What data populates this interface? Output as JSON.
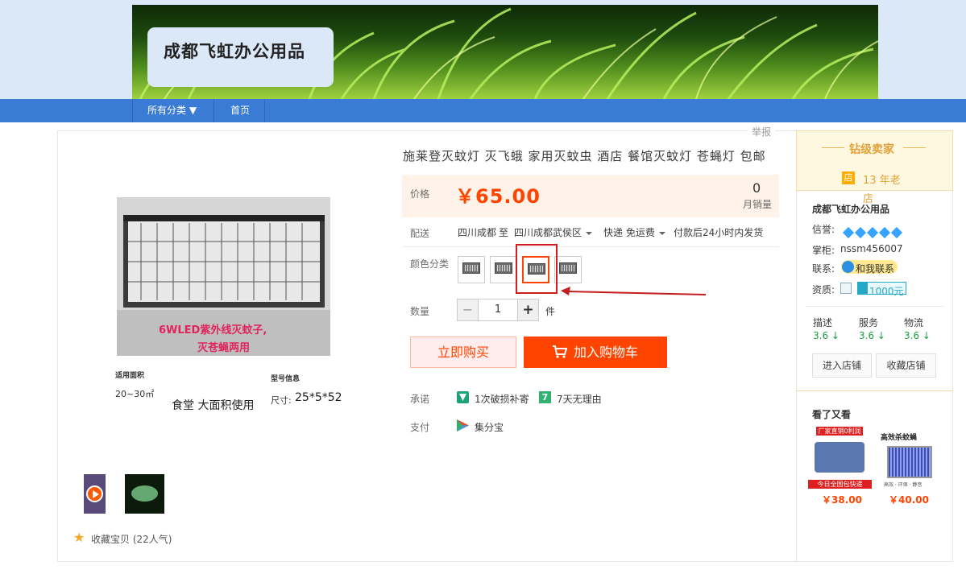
{
  "shop": {
    "name": "成都飞虹办公用品"
  },
  "nav": {
    "items": [
      {
        "label": "所有分类 ▼"
      },
      {
        "label": "首页"
      }
    ]
  },
  "report_label": "举报",
  "product": {
    "title": "施莱登灭蚊灯 灭飞蛾 家用灭蚊虫 酒店 餐馆灭蚊灯 苍蝇灯 包邮",
    "image_caption_line1": "6WLED紫外线灭蚊子,",
    "image_caption_line2": "灭苍蝇两用",
    "info_area_label": "适用面积",
    "info_area_value": "20~30㎡",
    "info_model_label": "型号信息",
    "info_size_label": "尺寸:",
    "info_size_value": "25*5*52",
    "info_usage": "食堂 大面积使用",
    "price_label": "价格",
    "price": "￥65.00",
    "sales_count": "0",
    "sales_label": "月销量",
    "shipping_label": "配送",
    "ship_from": "四川成都",
    "ship_to_word": "至",
    "ship_to": "四川成都武侯区",
    "ship_method": "快递 免运费",
    "ship_time": "付款后24小时内发货",
    "color_label": "颜色分类",
    "quantity_label": "数量",
    "quantity_value": "1",
    "quantity_unit": "件",
    "qty_minus": "−",
    "qty_plus": "+",
    "buy_now": "立即购买",
    "add_to_cart": "加入购物车",
    "promise_label": "承诺",
    "promise_1": "1次破损补寄",
    "promise_2": "7天无理由",
    "payment_label": "支付",
    "payment_method": "集分宝",
    "favorite": "收藏宝贝 (22人气)",
    "promise_2_icon": "7"
  },
  "seller": {
    "level": "钻级卖家",
    "years": "13 年老店",
    "shop_icon_text": "店",
    "shop_name": "成都飞虹办公用品",
    "credit_label": "信誉:",
    "keeper_label": "掌柜:",
    "keeper": "nssm456007",
    "contact_label": "联系:",
    "contact_btn": "和我联系",
    "qualification_label": "资质:",
    "deposit": "1000元",
    "ratings": [
      {
        "label": "描述",
        "value": "3.6"
      },
      {
        "label": "服务",
        "value": "3.6"
      },
      {
        "label": "物流",
        "value": "3.6"
      }
    ],
    "enter_shop": "进入店铺",
    "favorite_shop": "收藏店铺"
  },
  "recommend": {
    "title": "看了又看",
    "items": [
      {
        "tag_top": "厂家直销0利润",
        "tag_bottom": "今日全国包快递",
        "price": "￥38.00"
      },
      {
        "tag_top": "高效杀蚊蝇",
        "tag_bottom": "高效 · 环保 · 静音",
        "price": "￥40.00"
      }
    ]
  },
  "colors": {
    "accent": "#ff4400",
    "nav": "#3a7bd5",
    "highlight": "#d21c1c"
  }
}
